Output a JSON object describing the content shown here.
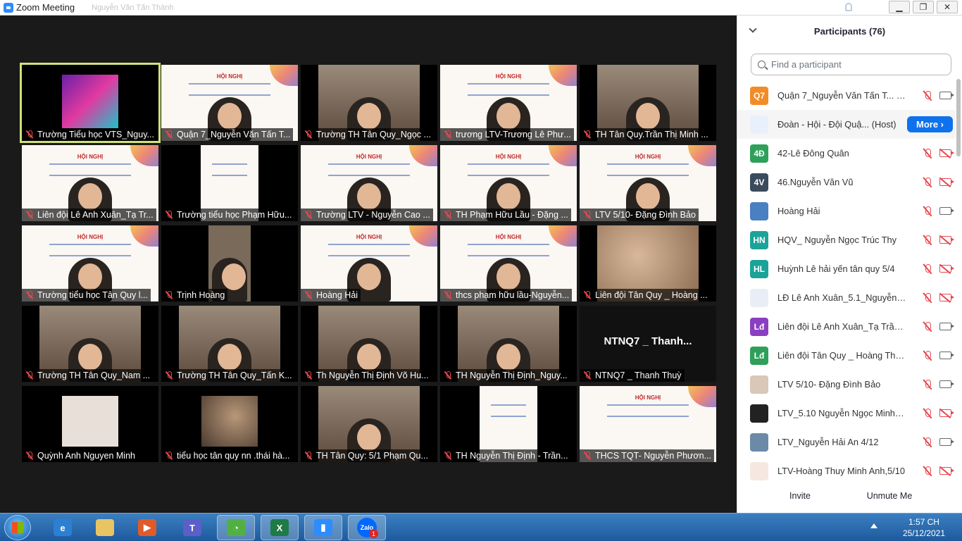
{
  "window": {
    "title": "Zoom Meeting",
    "subtitle": "Nguyễn Văn Tấn Thành"
  },
  "tiles": [
    {
      "name": "Trường Tiểu học VTS_Nguy...",
      "kind": "screen",
      "active": true
    },
    {
      "name": "Quận 7_Nguyễn Văn Tấn T...",
      "kind": "person-slide"
    },
    {
      "name": "Trường TH Tân Quy_Ngọc ...",
      "kind": "person-room"
    },
    {
      "name": "trương LTV-Trương Lê Phư...",
      "kind": "person-slide"
    },
    {
      "name": "TH Tân Quy.Trần Thị Minh ...",
      "kind": "person-room"
    },
    {
      "name": "Liên đội Lê Anh Xuân_Tạ Tr...",
      "kind": "person-slide"
    },
    {
      "name": "Trường tiểu học Phạm Hữu...",
      "kind": "slide-small"
    },
    {
      "name": "Trường LTV - Nguyễn Cao ...",
      "kind": "person-slide"
    },
    {
      "name": "TH Phạm Hữu Lầu - Đặng ...",
      "kind": "person-slide"
    },
    {
      "name": "LTV 5/10- Đặng Đình Bảo",
      "kind": "person-slide"
    },
    {
      "name": "Trường tiểu học Tân Quy l...",
      "kind": "person-slide"
    },
    {
      "name": "Trịnh Hoàng",
      "kind": "person-small"
    },
    {
      "name": "Hoàng Hải",
      "kind": "person-slide"
    },
    {
      "name": "thcs phạm hữu lầu-Nguyễn...",
      "kind": "person-slide"
    },
    {
      "name": "Liên đội Tân Quy _ Hoàng ...",
      "kind": "blur"
    },
    {
      "name": "Trường TH Tân Quy_Nam ...",
      "kind": "person-room"
    },
    {
      "name": "Trường TH Tân Quy_Tấn K...",
      "kind": "person-room"
    },
    {
      "name": "Th Nguyễn Thị Định Võ Hu...",
      "kind": "person-room"
    },
    {
      "name": "TH Nguyễn Thị Định_Nguy...",
      "kind": "person-room"
    },
    {
      "name": "NTNQ7 _ Thanh Thuỳ",
      "kind": "text",
      "big": "NTNQ7 _ Thanh..."
    },
    {
      "name": "Quỳnh Anh Nguyen Minh",
      "kind": "avatar-small"
    },
    {
      "name": "tiểu học tân quy nn .thái hà...",
      "kind": "dark-small"
    },
    {
      "name": "TH Tân Quy: 5/1 Phạm Qu...",
      "kind": "person-room"
    },
    {
      "name": "TH Nguyễn Thị Định - Trần...",
      "kind": "slide-small"
    },
    {
      "name": "THCS TQT- Nguyễn Phươn...",
      "kind": "slide"
    }
  ],
  "panel": {
    "title": "Participants (76)",
    "search_placeholder": "Find a participant",
    "more_label": "More",
    "invite_label": "Invite",
    "unmute_label": "Unmute Me",
    "participants": [
      {
        "initials": "Q7",
        "color": "#f28c28",
        "name": "Quận 7_Nguyễn Văn Tấn T... (Me)",
        "mic": "off",
        "cam": "on"
      },
      {
        "initials": "",
        "color": "#e8f1fb",
        "name": "Đoàn - Hội - Đội Quậ... (Host)",
        "host": true
      },
      {
        "initials": "4Đ",
        "color": "#2ea05a",
        "name": "42-Lê Đông Quân",
        "mic": "off",
        "cam": "off"
      },
      {
        "initials": "4V",
        "color": "#394b5c",
        "name": "46.Nguyễn Văn Vũ",
        "mic": "off",
        "cam": "off"
      },
      {
        "initials": "",
        "color": "#4a7fc1",
        "name": "Hoàng Hải",
        "mic": "off",
        "cam": "on"
      },
      {
        "initials": "HN",
        "color": "#1ba39a",
        "name": "HQV_ Nguyễn Ngọc Trúc Thy",
        "mic": "off",
        "cam": "off"
      },
      {
        "initials": "HL",
        "color": "#1ba39a",
        "name": "Huỳnh Lê hải yến tân quy 5/4",
        "mic": "off",
        "cam": "off"
      },
      {
        "initials": "",
        "color": "#e9eef6",
        "name": "LĐ Lê Anh Xuân_5.1_Nguyễn Thị...",
        "mic": "off",
        "cam": "off"
      },
      {
        "initials": "Lđ",
        "color": "#8a3fc0",
        "name": "Liên đội Lê Anh Xuân_Tạ Trần N...",
        "mic": "off",
        "cam": "on"
      },
      {
        "initials": "Lđ",
        "color": "#2ea05a",
        "name": "Liên đội Tân Quy _ Hoàng Thàn...",
        "mic": "off",
        "cam": "on"
      },
      {
        "initials": "",
        "color": "#d9c7b8",
        "name": "LTV 5/10- Đặng Đình Bảo",
        "mic": "off",
        "cam": "on"
      },
      {
        "initials": "",
        "color": "#222222",
        "name": "LTV_5.10 Nguyễn Ngọc Minh Vy",
        "mic": "off",
        "cam": "off"
      },
      {
        "initials": "",
        "color": "#6a8aa8",
        "name": "LTV_Nguyễn Hải An 4/12",
        "mic": "off",
        "cam": "on"
      },
      {
        "initials": "",
        "color": "#f6e7e0",
        "name": "LTV-Hoàng Thuy Minh Anh,5/10",
        "mic": "off",
        "cam": "off"
      }
    ]
  },
  "taskbar": {
    "apps": [
      {
        "name": "internet-explorer-icon",
        "glyph": "e",
        "color": "#2d7fd3"
      },
      {
        "name": "file-explorer-icon",
        "glyph": "",
        "color": "#e8c463"
      },
      {
        "name": "media-player-icon",
        "glyph": "▶",
        "color": "#e05a2a"
      },
      {
        "name": "teams-icon",
        "glyph": "T",
        "color": "#5b5fc7"
      },
      {
        "name": "coccoc-icon",
        "glyph": "◔",
        "color": "#52b043"
      },
      {
        "name": "excel-icon",
        "glyph": "X",
        "color": "#1f7a45"
      },
      {
        "name": "zoom-icon",
        "glyph": "▮",
        "color": "#2d8cff"
      },
      {
        "name": "zalo-icon",
        "glyph": "Zalo",
        "color": "#0068ff"
      }
    ],
    "zalo_badge": "1",
    "time": "1:57 CH",
    "date": "25/12/2021"
  }
}
